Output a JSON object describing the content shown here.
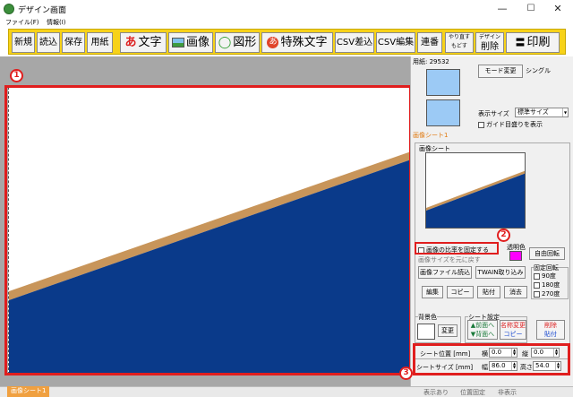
{
  "window": {
    "title": "デザイン画面",
    "minimize": "—",
    "maximize": "☐",
    "close": "✕"
  },
  "menu": [
    "ファイル(F)",
    "情報(I)"
  ],
  "toolbar": {
    "new": "新規",
    "load": "読込",
    "save": "保存",
    "paper": "用紙",
    "text_icon": "あ",
    "text": "文字",
    "image": "画像",
    "shape_icon": "◯",
    "shape": "図形",
    "special_icon": "あ",
    "special_text": "特殊文字",
    "csv_insert": "CSV差込",
    "csv_edit": "CSV編集",
    "serial": "連番",
    "undo": "やり直す",
    "redo": "もどす",
    "delete_top": "デザイン",
    "delete": "削除",
    "print_icon": "〓",
    "print": "印刷"
  },
  "callouts": {
    "one": "1",
    "two": "2",
    "three": "3"
  },
  "side": {
    "paper_no": "用紙: 29532",
    "mode_change": "モード変更",
    "mode_value": "シングル",
    "display_size_label": "表示サイズ",
    "display_size_value": "標準サイズ",
    "guide_label": "ガイド目盛りを表示",
    "image_sheet_title": "画像シート1",
    "image_sheet_group": "画像シート",
    "fix_ratio": "画像の比率を固定する",
    "fix_ratio_hidden": "画像サイズを元に戻す",
    "transparent": "透明色",
    "transparent_color": "#ff00ff",
    "free_rotate": "自由回転",
    "load_image": "画像ファイル読込",
    "twain": "TWAIN取り込み",
    "fixed_rotate": "固定回転",
    "rot_90": "90度",
    "rot_180": "180度",
    "rot_270": "270度",
    "edit": "編集",
    "copy": "コピー",
    "paste": "貼付",
    "erase": "消去",
    "bg_color": "背景色",
    "change": "変更",
    "sheet_setting": "シート設定",
    "front": "▲前面へ",
    "back": "▼背面へ",
    "rename": "名称変更",
    "copy2": "コピー",
    "del": "削除",
    "paste2": "貼付",
    "pos_label": "シート位置 [mm]",
    "x_label": "横",
    "x_value": "0.0",
    "y_label": "縦",
    "y_value": "0.0",
    "size_label": "シートサイズ [mm]",
    "w_label": "幅",
    "w_value": "86.0",
    "h_label": "高さ",
    "h_value": "54.0"
  },
  "status": {
    "sheet_tab": "画像シート1",
    "item1": "表示あり",
    "item2": "位置固定",
    "item3": "非表示"
  },
  "colors": {
    "accent_red": "#e01e1e",
    "toolbar_yellow": "#f7d218",
    "navy": "#0a3a8a",
    "bronze": "#c8955a",
    "preview_blue": "#9ccaf5",
    "tab_orange": "#f0a040"
  }
}
